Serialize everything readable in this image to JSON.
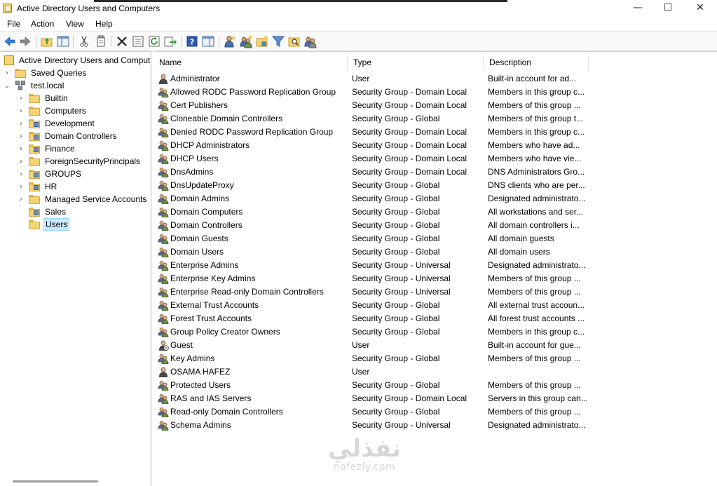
{
  "window": {
    "title": "Active Directory Users and Computers",
    "controls": {
      "minimize": "—",
      "maximize": "☐",
      "close": "✕"
    }
  },
  "menu": [
    "File",
    "Action",
    "View",
    "Help"
  ],
  "toolbar": {
    "buttons": [
      "back-icon",
      "forward-icon",
      "up-folder-icon",
      "show-hide-console-tree-icon",
      "cut-icon",
      "copy-icon",
      "delete-icon",
      "properties-icon",
      "refresh-icon",
      "export-list-icon",
      "help-icon",
      "show-action-pane-icon",
      "new-user-icon",
      "new-group-icon",
      "new-ou-icon",
      "filter-icon",
      "find-icon",
      "add-to-group-icon"
    ]
  },
  "tree": {
    "root": "Active Directory Users and Compute",
    "items": [
      {
        "label": "Saved Queries",
        "level": 1,
        "chevron": "›"
      },
      {
        "label": "test.local",
        "level": 1,
        "chevron": "⌄"
      },
      {
        "label": "Builtin",
        "level": 2,
        "chevron": "›"
      },
      {
        "label": "Computers",
        "level": 2,
        "chevron": "›"
      },
      {
        "label": "Development",
        "level": 2,
        "chevron": "›"
      },
      {
        "label": "Domain Controllers",
        "level": 2,
        "chevron": "›"
      },
      {
        "label": "Finance",
        "level": 2,
        "chevron": "›"
      },
      {
        "label": "ForeignSecurityPrincipals",
        "level": 2,
        "chevron": "›"
      },
      {
        "label": "GROUPS",
        "level": 2,
        "chevron": "›"
      },
      {
        "label": "HR",
        "level": 2,
        "chevron": "›"
      },
      {
        "label": "Managed Service Accounts",
        "level": 2,
        "chevron": "›"
      },
      {
        "label": "Sales",
        "level": 2,
        "chevron": ""
      },
      {
        "label": "Users",
        "level": 2,
        "chevron": "",
        "selected": true
      }
    ]
  },
  "list": {
    "columns": [
      "Name",
      "Type",
      "Description"
    ],
    "rows": [
      {
        "name": "Administrator",
        "type": "User",
        "desc": "Built-in account for ad...",
        "icon": "user"
      },
      {
        "name": "Allowed RODC Password Replication Group",
        "type": "Security Group - Domain Local",
        "desc": "Members in this group c...",
        "icon": "group"
      },
      {
        "name": "Cert Publishers",
        "type": "Security Group - Domain Local",
        "desc": "Members of this group ...",
        "icon": "group"
      },
      {
        "name": "Cloneable Domain Controllers",
        "type": "Security Group - Global",
        "desc": "Members of this group t...",
        "icon": "group"
      },
      {
        "name": "Denied RODC Password Replication Group",
        "type": "Security Group - Domain Local",
        "desc": "Members in this group c...",
        "icon": "group"
      },
      {
        "name": "DHCP Administrators",
        "type": "Security Group - Domain Local",
        "desc": "Members who have ad...",
        "icon": "group"
      },
      {
        "name": "DHCP Users",
        "type": "Security Group - Domain Local",
        "desc": "Members who have vie...",
        "icon": "group"
      },
      {
        "name": "DnsAdmins",
        "type": "Security Group - Domain Local",
        "desc": "DNS Administrators Gro...",
        "icon": "group"
      },
      {
        "name": "DnsUpdateProxy",
        "type": "Security Group - Global",
        "desc": "DNS clients who are per...",
        "icon": "group"
      },
      {
        "name": "Domain Admins",
        "type": "Security Group - Global",
        "desc": "Designated administrato...",
        "icon": "group"
      },
      {
        "name": "Domain Computers",
        "type": "Security Group - Global",
        "desc": "All workstations and ser...",
        "icon": "group"
      },
      {
        "name": "Domain Controllers",
        "type": "Security Group - Global",
        "desc": "All domain controllers i...",
        "icon": "group"
      },
      {
        "name": "Domain Guests",
        "type": "Security Group - Global",
        "desc": "All domain guests",
        "icon": "group"
      },
      {
        "name": "Domain Users",
        "type": "Security Group - Global",
        "desc": "All domain users",
        "icon": "group"
      },
      {
        "name": "Enterprise Admins",
        "type": "Security Group - Universal",
        "desc": "Designated administrato...",
        "icon": "group"
      },
      {
        "name": "Enterprise Key Admins",
        "type": "Security Group - Universal",
        "desc": "Members of this group ...",
        "icon": "group"
      },
      {
        "name": "Enterprise Read-only Domain Controllers",
        "type": "Security Group - Universal",
        "desc": "Members of this group ...",
        "icon": "group"
      },
      {
        "name": "External Trust Accounts",
        "type": "Security Group - Global",
        "desc": "All external trust accoun...",
        "icon": "group"
      },
      {
        "name": "Forest Trust Accounts",
        "type": "Security Group - Global",
        "desc": "All forest trust accounts ...",
        "icon": "group"
      },
      {
        "name": "Group Policy Creator Owners",
        "type": "Security Group - Global",
        "desc": "Members in this group c...",
        "icon": "group"
      },
      {
        "name": "Guest",
        "type": "User",
        "desc": "Built-in account for gue...",
        "icon": "user-disabled"
      },
      {
        "name": "Key Admins",
        "type": "Security Group - Global",
        "desc": "Members of this group ...",
        "icon": "group"
      },
      {
        "name": "OSAMA HAFEZ",
        "type": "User",
        "desc": "",
        "icon": "user"
      },
      {
        "name": "Protected Users",
        "type": "Security Group - Global",
        "desc": "Members of this group ...",
        "icon": "group"
      },
      {
        "name": "RAS and IAS Servers",
        "type": "Security Group - Domain Local",
        "desc": "Servers in this group can...",
        "icon": "group"
      },
      {
        "name": "Read-only Domain Controllers",
        "type": "Security Group - Global",
        "desc": "Members of this group ...",
        "icon": "group"
      },
      {
        "name": "Schema Admins",
        "type": "Security Group - Universal",
        "desc": "Designated administrato...",
        "icon": "group"
      }
    ]
  },
  "watermark": {
    "main": "نفذلي",
    "sub": "nafezly.com"
  },
  "colors": {
    "selection": "#cce8ff",
    "folder": "#f6d373",
    "toolbar_bg": "#fafafa"
  }
}
